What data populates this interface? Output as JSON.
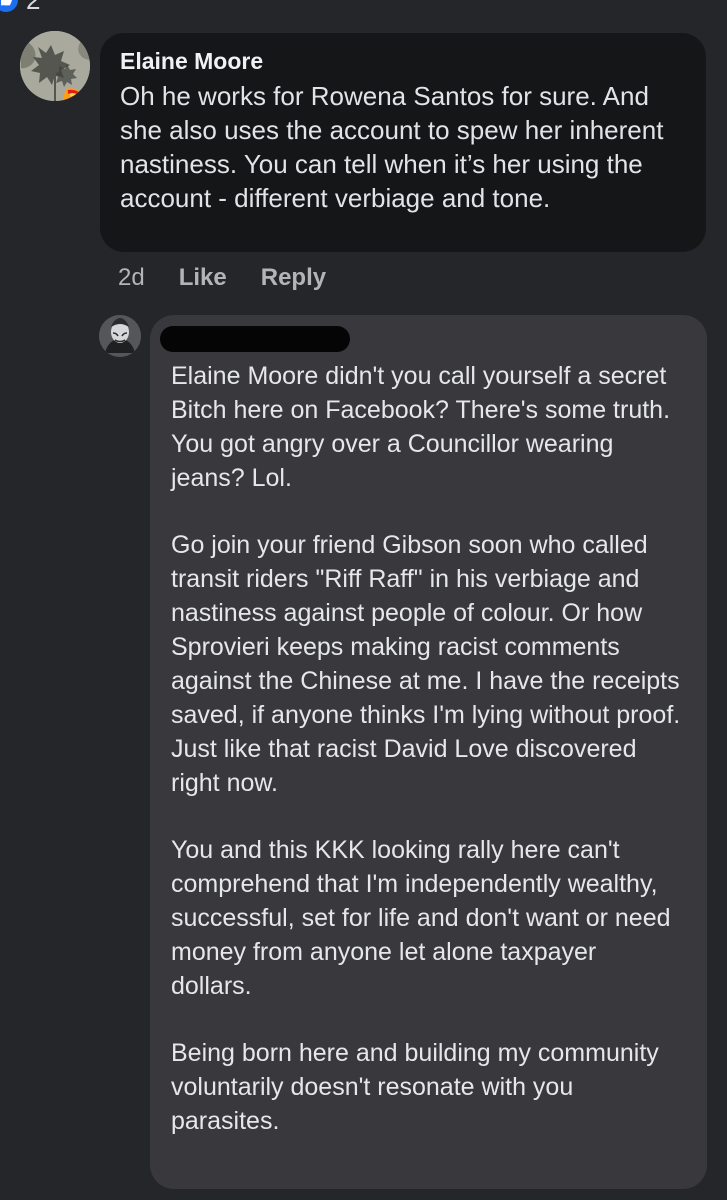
{
  "top_reaction": {
    "icon": "like-icon",
    "count": "2"
  },
  "comment": {
    "author": "Elaine Moore",
    "text": "Oh he works for Rowena Santos for sure.  And she also uses the account to spew her inherent nastiness.  You can tell when it’s her using the account - different verbiage and tone.",
    "time": "2d",
    "like_label": "Like",
    "reply_label": "Reply"
  },
  "reply": {
    "paragraphs": [
      "Elaine Moore didn't you call yourself a secret Bitch here on Facebook? There's some truth.  You got angry over a Councillor wearing jeans? Lol.",
      "Go join your friend Gibson soon who called transit riders \"Riff Raff\" in his verbiage and nastiness against people of colour. Or how Sprovieri keeps making racist comments against the Chinese at me. I have the receipts saved, if anyone thinks I'm lying without proof. Just like that racist David Love discovered right now.",
      "You and this KKK looking rally here can't comprehend that I'm independently wealthy, successful, set for life and don't want or need money from anyone let alone taxpayer dollars.",
      "Being born here and building my community voluntarily doesn't resonate with you parasites."
    ]
  },
  "colors": {
    "background": "#252629",
    "comment_bubble": "#151618",
    "reply_bubble": "#39393d",
    "like_badge": "#1d6ff2"
  }
}
